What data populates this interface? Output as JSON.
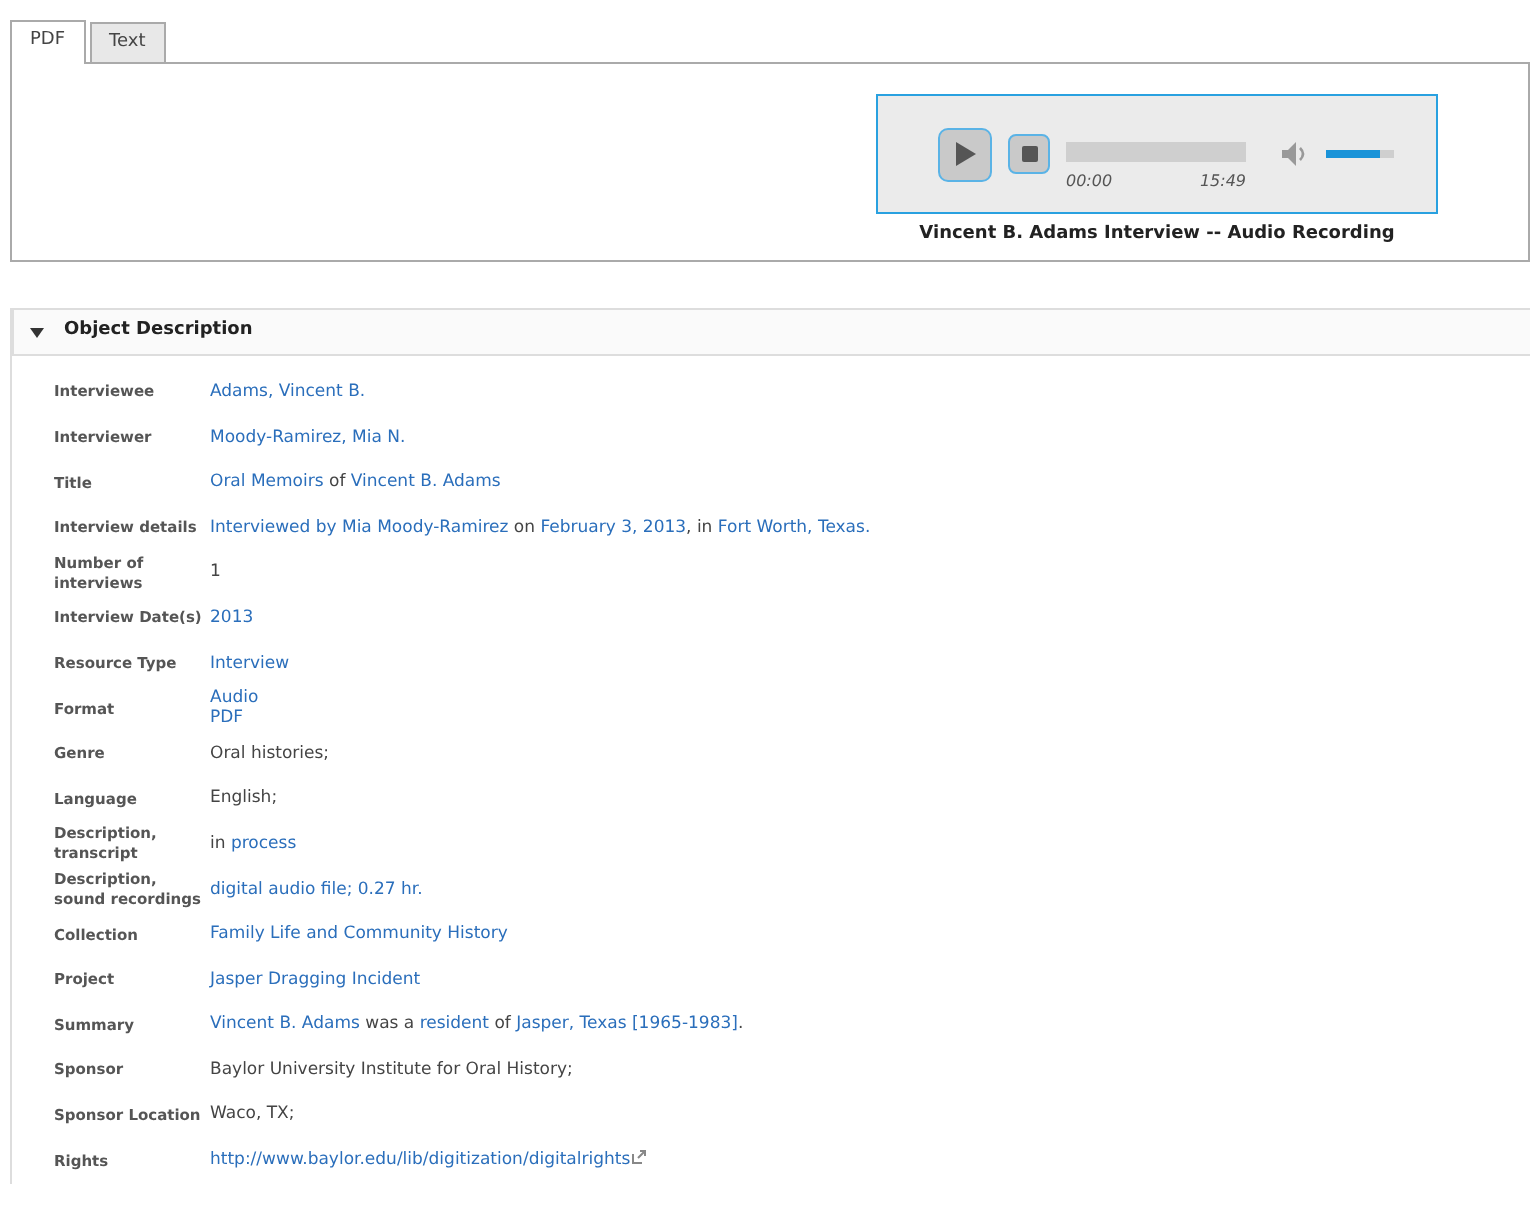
{
  "tabs": [
    {
      "label": "PDF",
      "selected": true
    },
    {
      "label": "Text",
      "selected": false
    }
  ],
  "player": {
    "time_current": "00:00",
    "time_total": "15:49",
    "progress": {
      "level": 0
    },
    "volume": {
      "level": 0.8
    },
    "caption": "Vincent B. Adams Interview -- Audio Recording"
  },
  "section": {
    "title": "Object Description",
    "expanded": true,
    "rows": [
      {
        "label": "Interviewee",
        "lines": [
          [
            {
              "kind": "link",
              "text": "Adams, Vincent B."
            }
          ]
        ]
      },
      {
        "label": "Interviewer",
        "lines": [
          [
            {
              "kind": "link",
              "text": "Moody-Ramirez, Mia N."
            }
          ]
        ]
      },
      {
        "label": "Title",
        "lines": [
          [
            {
              "kind": "link",
              "text": "Oral Memoirs"
            },
            {
              "kind": "text",
              "text": " of "
            },
            {
              "kind": "link",
              "text": "Vincent B. Adams"
            }
          ]
        ]
      },
      {
        "label": "Interview details",
        "lines": [
          [
            {
              "kind": "link",
              "text": "Interviewed by Mia Moody-Ramirez"
            },
            {
              "kind": "text",
              "text": " on "
            },
            {
              "kind": "link",
              "text": "February 3, 2013"
            },
            {
              "kind": "text",
              "text": ", in "
            },
            {
              "kind": "link",
              "text": "Fort Worth, Texas."
            }
          ]
        ]
      },
      {
        "label": "Number of interviews",
        "lines": [
          [
            {
              "kind": "text",
              "text": "1"
            }
          ]
        ]
      },
      {
        "label": "Interview Date(s)",
        "lines": [
          [
            {
              "kind": "link",
              "text": "2013"
            }
          ]
        ]
      },
      {
        "label": "Resource Type",
        "lines": [
          [
            {
              "kind": "link",
              "text": "Interview"
            }
          ]
        ]
      },
      {
        "label": "Format",
        "lines": [
          [
            {
              "kind": "link",
              "text": "Audio"
            }
          ],
          [
            {
              "kind": "link",
              "text": "PDF"
            }
          ]
        ]
      },
      {
        "label": "Genre",
        "lines": [
          [
            {
              "kind": "text",
              "text": "Oral histories;"
            }
          ]
        ]
      },
      {
        "label": "Language",
        "lines": [
          [
            {
              "kind": "text",
              "text": "English;"
            }
          ]
        ]
      },
      {
        "label": "Description, transcript",
        "lines": [
          [
            {
              "kind": "text",
              "text": "in "
            },
            {
              "kind": "link",
              "text": "process"
            }
          ]
        ]
      },
      {
        "label": "Description, sound recordings",
        "lines": [
          [
            {
              "kind": "link",
              "text": "digital audio file; 0.27 hr."
            }
          ]
        ]
      },
      {
        "label": "Collection",
        "lines": [
          [
            {
              "kind": "link",
              "text": "Family Life and Community History"
            }
          ]
        ]
      },
      {
        "label": "Project",
        "lines": [
          [
            {
              "kind": "link",
              "text": "Jasper Dragging Incident"
            }
          ]
        ]
      },
      {
        "label": "Summary",
        "lines": [
          [
            {
              "kind": "link",
              "text": "Vincent B. Adams"
            },
            {
              "kind": "text",
              "text": " was a "
            },
            {
              "kind": "link",
              "text": "resident"
            },
            {
              "kind": "text",
              "text": " of "
            },
            {
              "kind": "link",
              "text": "Jasper, Texas [1965-1983]"
            },
            {
              "kind": "text",
              "text": "."
            }
          ]
        ]
      },
      {
        "label": "Sponsor",
        "lines": [
          [
            {
              "kind": "text",
              "text": "Baylor University Institute for Oral History;"
            }
          ]
        ]
      },
      {
        "label": "Sponsor Location",
        "lines": [
          [
            {
              "kind": "text",
              "text": "Waco, TX;"
            }
          ]
        ]
      },
      {
        "label": "Rights",
        "lines": [
          [
            {
              "kind": "external",
              "text": "http://www.baylor.edu/lib/digitization/digitalrights"
            }
          ]
        ]
      }
    ]
  }
}
